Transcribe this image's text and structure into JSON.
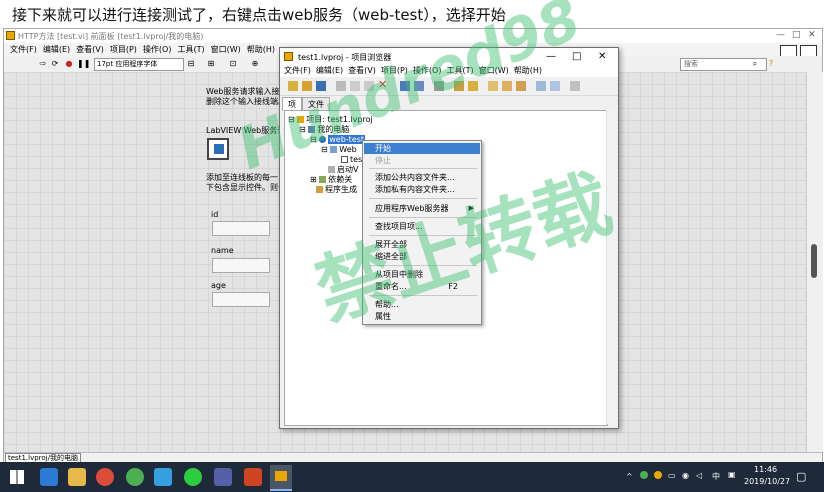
{
  "caption": "接下来就可以进行连接测试了，右键点击web服务（web-test），选择开始",
  "back_window": {
    "title": "HTTP方法 [test.vi] 前面板 (test1.lvproj/我的电脑)",
    "menu": [
      "文件(F)",
      "编辑(E)",
      "查看(V)",
      "项目(P)",
      "操作(O)",
      "工具(T)",
      "窗口(W)",
      "帮助(H)"
    ],
    "font_select": "17pt 应用程序字体",
    "search_placeholder": "搜索",
    "note1_line1": "Web服务请求输入接线",
    "note1_line2": "删除这个输入接线端。",
    "note2_title": "LabVIEW Web服务请",
    "note3_line1": "添加至连线板的每一",
    "note3_line2": "下包含显示控件。则请",
    "fields": [
      {
        "label": "id",
        "value": ""
      },
      {
        "label": "name",
        "value": ""
      },
      {
        "label": "age",
        "value": ""
      }
    ],
    "status_path": "test1.lvproj/我的电脑"
  },
  "explorer": {
    "title": "test1.lvproj - 项目浏览器",
    "menu": [
      "文件(F)",
      "编辑(E)",
      "查看(V)",
      "项目(P)",
      "操作(O)",
      "工具(T)",
      "窗口(W)",
      "帮助(H)"
    ],
    "tabs": [
      "项",
      "文件"
    ],
    "tree": {
      "project": "项目: test1.lvproj",
      "computer": "我的电脑",
      "webservice": "web-test",
      "web_folder": "Web",
      "vi": "tes",
      "startup": "启动V",
      "dependencies": "依赖关",
      "build": "程序生成"
    }
  },
  "context_menu": {
    "items": [
      {
        "label": "开始",
        "state": "highlighted"
      },
      {
        "label": "停止",
        "state": "disabled"
      },
      {
        "label": "添加公共内容文件夹...",
        "state": "normal"
      },
      {
        "label": "添加私有内容文件夹...",
        "state": "normal"
      },
      {
        "label": "应用程序Web服务器",
        "state": "submenu"
      },
      {
        "label": "查找项目项...",
        "state": "normal"
      },
      {
        "label": "展开全部",
        "state": "normal"
      },
      {
        "label": "缩进全部",
        "state": "normal"
      },
      {
        "label": "从项目中删除",
        "state": "normal"
      },
      {
        "label": "重命名...",
        "state": "normal",
        "shortcut": "F2"
      },
      {
        "label": "帮助...",
        "state": "normal"
      },
      {
        "label": "属性",
        "state": "normal"
      }
    ]
  },
  "watermark": {
    "line1": "Hundred98",
    "line2": "禁止转载"
  },
  "taskbar": {
    "time": "11:46",
    "date": "2019/10/27",
    "ime": "中"
  },
  "colors": {
    "highlight": "#3d7fcf",
    "taskbar": "#1e2a3a",
    "watermark": "#3cbe6e"
  }
}
